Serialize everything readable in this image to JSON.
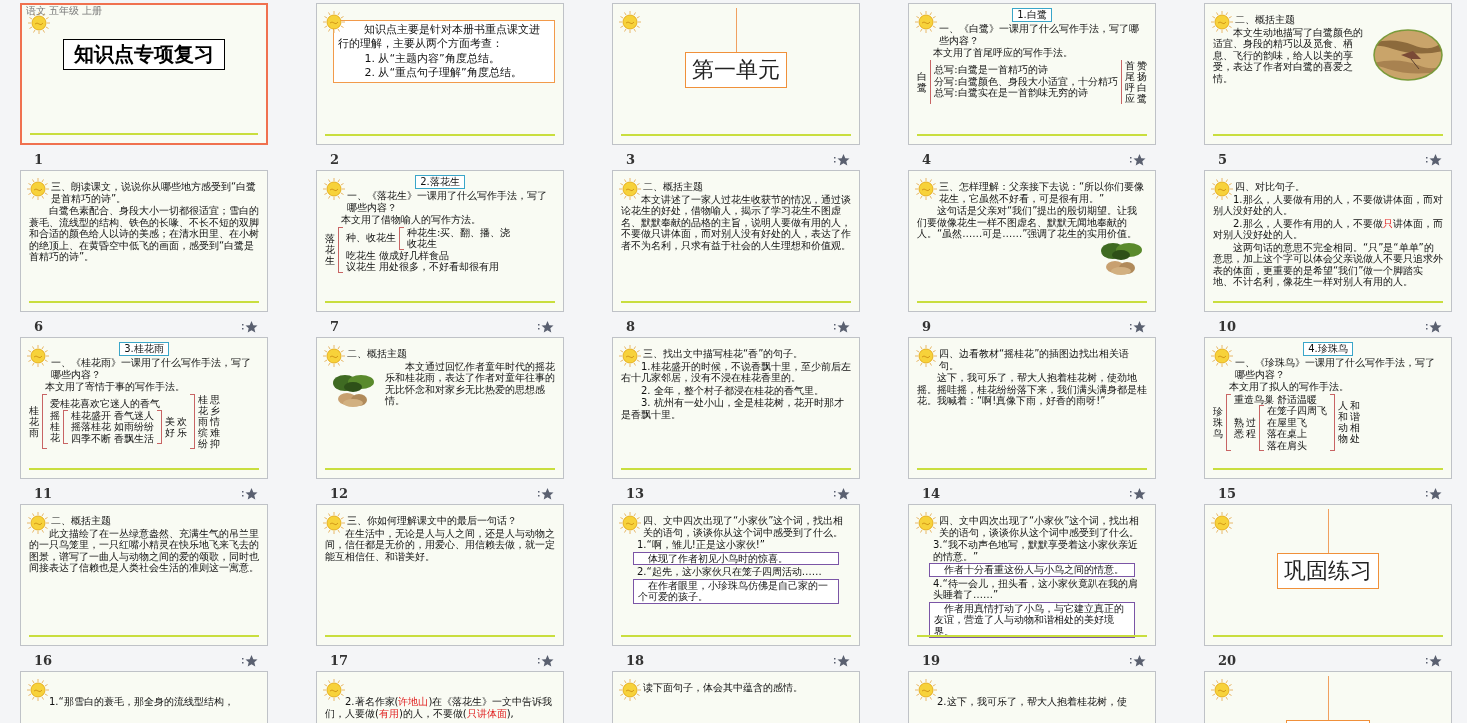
{
  "slides": [
    {
      "number": "1",
      "selected": true,
      "animated": false,
      "corner_text": "语文 五年级 上册",
      "blocks": [
        {
          "kind": "title_box",
          "text": "知识点专项复习"
        }
      ]
    },
    {
      "number": "2",
      "selected": false,
      "animated": false,
      "blocks": [
        {
          "kind": "outline",
          "lines": [
            "知识点主要是针对本册书重点课文进行的理解，主要从两个方面考查：",
            "1. 从“主题内容”角度总结。",
            "2. 从“重点句子理解”角度总结。"
          ]
        }
      ]
    },
    {
      "number": "3",
      "selected": false,
      "animated": true,
      "blocks": [
        {
          "kind": "section",
          "text": "第一单元"
        }
      ]
    },
    {
      "number": "4",
      "selected": false,
      "animated": true,
      "blocks": [
        {
          "kind": "tag",
          "text": "1.白鹭"
        },
        {
          "kind": "heading",
          "text": "一、《白鹭》一课用了什么写作手法，写了哪些内容？"
        },
        {
          "kind": "line",
          "text": "本文用了首尾呼应的写作手法。"
        },
        {
          "kind": "tree",
          "vertical": true,
          "label": [
            "白鹭"
          ],
          "items": [
            "总写:白鹭是一首精巧的诗",
            "分写:白鹭颜色、身段大小适宜，十分精巧",
            "总写:白鹭实在是一首韵味无穷的诗"
          ],
          "result": [
            "首尾呼应",
            "赞扬白鹭"
          ]
        }
      ]
    },
    {
      "number": "5",
      "selected": false,
      "animated": true,
      "blocks": [
        {
          "kind": "heading",
          "text": "二、概括主题"
        },
        {
          "kind": "row",
          "blocks": [
            {
              "kind": "paragraph",
              "text": "本文生动地描写了白鹭颜色的适宜、身段的精巧以及觅食、栖息、飞行的韵味，给人以美的享受，表达了作者对白鹭的喜爱之情。"
            },
            {
              "kind": "picture"
            }
          ]
        }
      ]
    },
    {
      "number": "6",
      "selected": false,
      "animated": true,
      "blocks": [
        {
          "kind": "heading",
          "text": "三、朗读课文，说说你从哪些地方感受到“白鹭是首精巧的诗”。"
        },
        {
          "kind": "paragraph",
          "text": "白鹭色素配合、身段大小一切都很适宜；雪白的蓑毛、流线型的结构、铁色的长喙、不长不短的双脚和合适的颜色给人以诗的美感；在清水田里、在小树的绝顶上、在黄昏空中低飞的画面，感受到“白鹭是首精巧的诗”。"
        }
      ]
    },
    {
      "number": "7",
      "selected": false,
      "animated": true,
      "blocks": [
        {
          "kind": "tag",
          "text": "2.落花生"
        },
        {
          "kind": "heading",
          "text": "一、《落花生》一课用了什么写作手法，写了哪些内容？"
        },
        {
          "kind": "line",
          "text": "本文用了借物喻人的写作方法。"
        },
        {
          "kind": "tree",
          "vertical": true,
          "label": [
            "落花生"
          ],
          "items": [
            {
              "vertical": false,
              "label": [
                "种、收花生"
              ],
              "items": [
                "种花生:买、翻、播、浇",
                "收花生"
              ]
            },
            "吃花生 做成好几样食品",
            "议花生 用处很多，不好看却很有用"
          ]
        }
      ]
    },
    {
      "number": "8",
      "selected": false,
      "animated": true,
      "blocks": [
        {
          "kind": "heading",
          "text": "二、概括主题"
        },
        {
          "kind": "paragraph",
          "text": "本文讲述了一家人过花生收获节的情况，通过谈论花生的好处，借物喻人，揭示了学习花生不图虚名、默默奉献的品格的主旨，说明人要做有用的人，不要做只讲体面，而对别人没有好处的人，表达了作者不为名利，只求有益于社会的人生理想和价值观。"
        }
      ]
    },
    {
      "number": "9",
      "selected": false,
      "animated": true,
      "blocks": [
        {
          "kind": "heading",
          "text": "三、怎样理解：父亲接下去说：“所以你们要像花生，它虽然不好看，可是很有用。”"
        },
        {
          "kind": "paragraph",
          "text": "这句话是父亲对“我们”提出的殷切期望。让我们要做像花生一样不图虚名、默默无闻地奉献的人。“虽然……可是……”强调了花生的实用价值。"
        },
        {
          "kind": "picture"
        }
      ]
    },
    {
      "number": "10",
      "selected": false,
      "animated": true,
      "blocks": [
        {
          "kind": "heading",
          "text": "四、对比句子。"
        },
        {
          "kind": "item",
          "parts": [
            {
              "text": "1.那么，人要做有用的人，不要做讲体面，而对别人没好处的人。",
              "highlight": false
            }
          ]
        },
        {
          "kind": "item",
          "parts": [
            {
              "text": "2.那么，人要作有用的人，不要做",
              "highlight": false
            },
            {
              "text": "只",
              "highlight": true
            },
            {
              "text": "讲体面，而对别人没好处的人。",
              "highlight": false
            }
          ]
        },
        {
          "kind": "paragraph",
          "text": "这两句话的意思不完全相同。“只”是“单单”的意思，加上这个字可以体会父亲说做人不要只追求外表的体面，更重要的是希望“我们”做一个脚踏实地、不计名利，像花生一样对别人有用的人。"
        }
      ]
    },
    {
      "number": "11",
      "selected": false,
      "animated": true,
      "blocks": [
        {
          "kind": "tag",
          "text": "3.桂花雨"
        },
        {
          "kind": "heading",
          "text": "一、《桂花雨》一课用了什么写作手法，写了哪些内容？"
        },
        {
          "kind": "line",
          "text": "本文用了寄情于事的写作手法。"
        },
        {
          "kind": "tree",
          "vertical": true,
          "label": [
            "桂花雨"
          ],
          "items": [
            "爱桂花喜欢它迷人的香气",
            {
              "vertical": true,
              "label": [
                "摇桂花"
              ],
              "items": [
                "桂花盛开 香气迷人",
                "摇落桂花 如雨纷纷",
                "四季不断 香飘生活"
              ],
              "result": [
                "美好",
                "欢乐"
              ]
            }
          ],
          "result": [
            "桂花雨缤纷",
            "思乡情难抑"
          ]
        }
      ]
    },
    {
      "number": "12",
      "selected": false,
      "animated": true,
      "blocks": [
        {
          "kind": "heading",
          "text": "二、概括主题"
        },
        {
          "kind": "row",
          "blocks": [
            {
              "kind": "picture"
            },
            {
              "kind": "paragraph",
              "text": "本文通过回忆作者童年时代的摇花乐和桂花雨，表达了作者对童年往事的无比怀念和对家乡无比热爱的思想感情。"
            }
          ]
        }
      ]
    },
    {
      "number": "13",
      "selected": false,
      "animated": true,
      "blocks": [
        {
          "kind": "heading",
          "text": "三、找出文中描写桂花“香”的句子。"
        },
        {
          "kind": "paragraph",
          "text": "1.桂花盛开的时候，不说香飘十里，至少前后左右十几家邻居，没有不浸在桂花香里的。"
        },
        {
          "kind": "paragraph",
          "text": "2. 全年，整个村子都浸在桂花的香气里。"
        },
        {
          "kind": "paragraph",
          "text": "3. 杭州有一处小山，全是桂花树，花开时那才是香飘十里。"
        }
      ]
    },
    {
      "number": "14",
      "selected": false,
      "animated": true,
      "blocks": [
        {
          "kind": "heading",
          "text": "四、边看教材“摇桂花”的插图边找出相关语句。"
        },
        {
          "kind": "paragraph",
          "text": "这下，我可乐了，帮大人抱着桂花树，使劲地摇。摇哇摇，桂花纷纷落下来，我们满头满身都是桂花。我喊着：“啊!真像下雨，好香的雨呀!”"
        }
      ]
    },
    {
      "number": "15",
      "selected": false,
      "animated": true,
      "blocks": [
        {
          "kind": "tag",
          "text": "4.珍珠鸟"
        },
        {
          "kind": "heading",
          "text": "一、《珍珠鸟》一课用了什么写作手法，写了哪些内容？"
        },
        {
          "kind": "line",
          "text": "本文用了拟人的写作手法。"
        },
        {
          "kind": "tree",
          "vertical": true,
          "label": [
            "珍珠鸟"
          ],
          "items": [
            "重造鸟巢 舒适温暖",
            {
              "vertical": true,
              "label": [
                "熟悉",
                "过程"
              ],
              "items": [
                "在笼子四周飞",
                "在屋里飞",
                "落在桌上",
                "落在肩头"
              ]
            }
          ],
          "result": [
            "人和动物",
            "和谐相处"
          ]
        }
      ]
    },
    {
      "number": "16",
      "selected": false,
      "animated": true,
      "blocks": [
        {
          "kind": "heading",
          "text": "二、概括主题"
        },
        {
          "kind": "paragraph",
          "text": "此文描绘了在一丛绿意盎然、充满生气的吊兰里的一只鸟笼里，一只红嘴小精灵在快乐地飞来飞去的图景，谱写了一曲人与动物之间的爱的颂歌，同时也间接表达了信赖也是人类社会生活的准则这一寓意。"
        }
      ]
    },
    {
      "number": "17",
      "selected": false,
      "animated": true,
      "blocks": [
        {
          "kind": "heading",
          "text": "三、你如何理解课文中的最后一句话？"
        },
        {
          "kind": "paragraph",
          "text": "在生活中，无论是人与人之间，还是人与动物之间，信任都是无价的，用爱心、用信赖去做，就一定能互相信任、和谐美好。"
        }
      ]
    },
    {
      "number": "18",
      "selected": false,
      "animated": true,
      "blocks": [
        {
          "kind": "heading",
          "text": "四、文中四次出现了“小家伙”这个词，找出相关的语句，谈谈你从这个词中感受到了什么。"
        },
        {
          "kind": "line",
          "text": "1.“啊，雏儿!正是这小家伙!”"
        },
        {
          "kind": "note",
          "text": "体现了作者初见小鸟时的惊喜。"
        },
        {
          "kind": "line",
          "text": "2.“起先，这小家伙只在笼子四周活动……"
        },
        {
          "kind": "note",
          "text": "在作者眼里，小珍珠鸟仿佛是自己家的一个可爱的孩子。"
        }
      ]
    },
    {
      "number": "19",
      "selected": false,
      "animated": true,
      "blocks": [
        {
          "kind": "heading",
          "text": "四、文中四次出现了“小家伙”这个词，找出相关的语句，谈谈你从这个词中感受到了什么。"
        },
        {
          "kind": "line",
          "text": "3.“我不动声色地写，默默享受着这小家伙亲近的情意。”"
        },
        {
          "kind": "note",
          "text": "作者十分看重这份人与小鸟之间的情意。"
        },
        {
          "kind": "line",
          "text": "4.“待一会儿，扭头看，这小家伙竟趴在我的肩头睡着了……”"
        },
        {
          "kind": "note",
          "text": "作者用真情打动了小鸟，与它建立真正的友谊，营造了人与动物和谐相处的美好境界。"
        }
      ]
    },
    {
      "number": "20",
      "selected": false,
      "animated": true,
      "blocks": [
        {
          "kind": "section",
          "text": "巩固练习"
        }
      ]
    },
    {
      "selected": false,
      "blocks": [
        {
          "kind": "paragraph",
          "text": "1.“那雪白的蓑毛，那全身的流线型结构，"
        }
      ]
    },
    {
      "selected": false,
      "blocks": [
        {
          "kind": "item",
          "parts": [
            {
              "text": "2.著名作家(",
              "highlight": false
            },
            {
              "text": "许地山",
              "highlight": true
            },
            {
              "text": ")在《落花生》一文中告诉我们，人要做(",
              "highlight": false
            },
            {
              "text": "有用",
              "highlight": true
            },
            {
              "text": ")的人，不要做(",
              "highlight": false
            },
            {
              "text": "只讲体面",
              "highlight": true
            },
            {
              "text": "),",
              "highlight": false
            }
          ]
        }
      ]
    },
    {
      "selected": false,
      "blocks": [
        {
          "kind": "heading",
          "text": "读下面句子，体会其中蕴含的感情。"
        }
      ]
    },
    {
      "selected": false,
      "blocks": [
        {
          "kind": "paragraph",
          "text": "2.这下，我可乐了，帮大人抱着桂花树，使"
        }
      ]
    },
    {
      "selected": false,
      "blocks": [
        {
          "kind": "section"
        }
      ]
    }
  ]
}
